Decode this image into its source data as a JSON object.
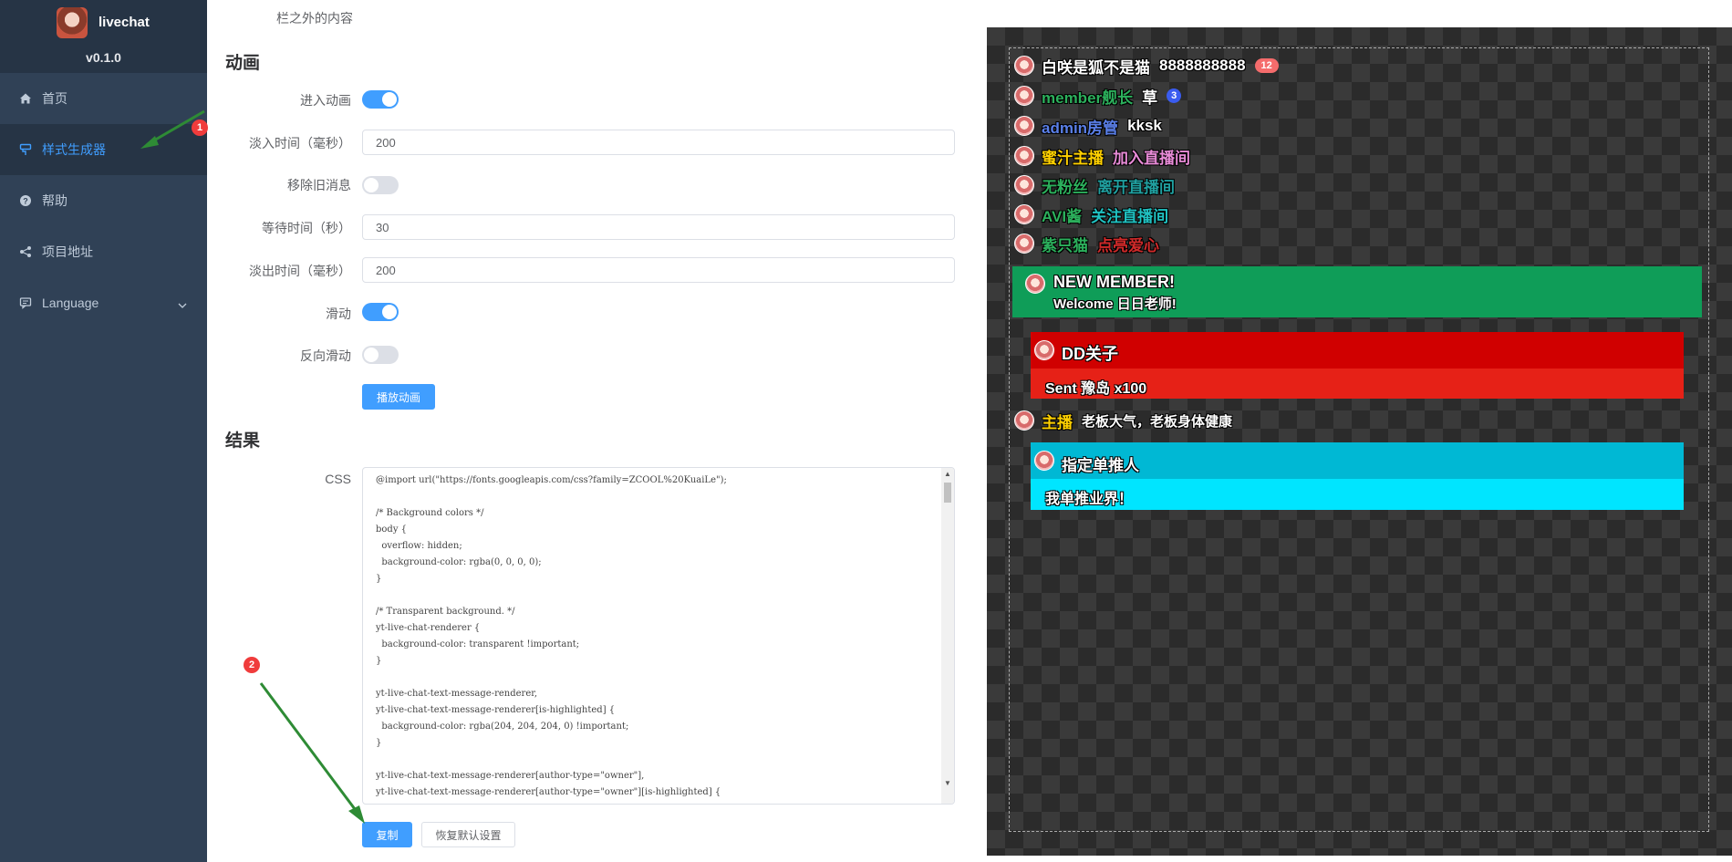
{
  "app": {
    "name": "livechat",
    "version": "v0.1.0"
  },
  "sidebar": {
    "items": [
      {
        "label": "首页",
        "icon": "home-icon"
      },
      {
        "label": "样式生成器",
        "icon": "brush-icon",
        "active": true
      },
      {
        "label": "帮助",
        "icon": "help-icon"
      },
      {
        "label": "项目地址",
        "icon": "share-icon"
      },
      {
        "label": "Language",
        "icon": "language-icon"
      }
    ]
  },
  "form": {
    "cut_label": "栏之外的内容",
    "animation": {
      "title": "动画",
      "enter_label": "进入动画",
      "enter_on": true,
      "fade_in_label": "淡入时间（毫秒）",
      "fade_in_value": "200",
      "remove_old_label": "移除旧消息",
      "remove_old_on": false,
      "wait_label": "等待时间（秒）",
      "wait_value": "30",
      "fade_out_label": "淡出时间（毫秒）",
      "fade_out_value": "200",
      "slide_label": "滑动",
      "slide_on": true,
      "reverse_label": "反向滑动",
      "reverse_on": false,
      "play_button": "播放动画"
    },
    "result": {
      "title": "结果",
      "css_label": "CSS",
      "css_text": "@import url(\"https://fonts.googleapis.com/css?family=ZCOOL%20KuaiLe\");\n\n/* Background colors */\nbody {\n  overflow: hidden;\n  background-color: rgba(0, 0, 0, 0);\n}\n\n/* Transparent background. */\nyt-live-chat-renderer {\n  background-color: transparent !important;\n}\n\nyt-live-chat-text-message-renderer,\nyt-live-chat-text-message-renderer[is-highlighted] {\n  background-color: rgba(204, 204, 204, 0) !important;\n}\n\nyt-live-chat-text-message-renderer[author-type=\"owner\"],\nyt-live-chat-text-message-renderer[author-type=\"owner\"][is-highlighted] {",
      "copy_button": "复制",
      "reset_button": "恢复默认设置"
    },
    "annotations": {
      "step1": "1",
      "step2": "2"
    }
  },
  "preview": {
    "lines": [
      {
        "author": "白咲是狐不是猫",
        "message": "8888888888",
        "author_color": "#ffffff",
        "message_color": "#ffffff",
        "badge": "12",
        "badge_color": "#f56c6c"
      },
      {
        "author": "member舰长",
        "message": "草",
        "author_color": "#2cb05c",
        "message_color": "#ffffff",
        "badge": "3",
        "badge_color": "#3a5cf0"
      },
      {
        "author": "admin房管",
        "message": "kksk",
        "author_color": "#5a7fe8",
        "message_color": "#ffffff"
      },
      {
        "author": "蜜汁主播",
        "message": "加入直播间",
        "author_color": "#ffd100",
        "message_color": "#e88bd7"
      },
      {
        "author": "无粉丝",
        "message": "离开直播间",
        "author_color": "#2cb05c",
        "message_color": "#20a0a0"
      },
      {
        "author": "AVI酱",
        "message": "关注直播间",
        "author_color": "#2cb05c",
        "message_color": "#20c2c2"
      },
      {
        "author": "紫只猫",
        "message": "点亮爱心",
        "author_color": "#2cb05c",
        "message_color": "#d02a2a"
      }
    ],
    "new_member": {
      "title": "NEW MEMBER!",
      "subtitle": "Welcome 日日老师!",
      "color": "#0f9d58"
    },
    "gift": {
      "author": "DD关子",
      "message": "Sent 豫岛 x100",
      "header_color": "#d00000",
      "body_color": "#e62117"
    },
    "owner_line": {
      "author": "主播",
      "message": "老板大气，老板身体健康",
      "author_color": "#ffd100"
    },
    "superchat": {
      "author": "指定单推人",
      "message": "我单推业界！",
      "header_color": "#00b8d4",
      "body_color": "#00e5ff"
    }
  }
}
